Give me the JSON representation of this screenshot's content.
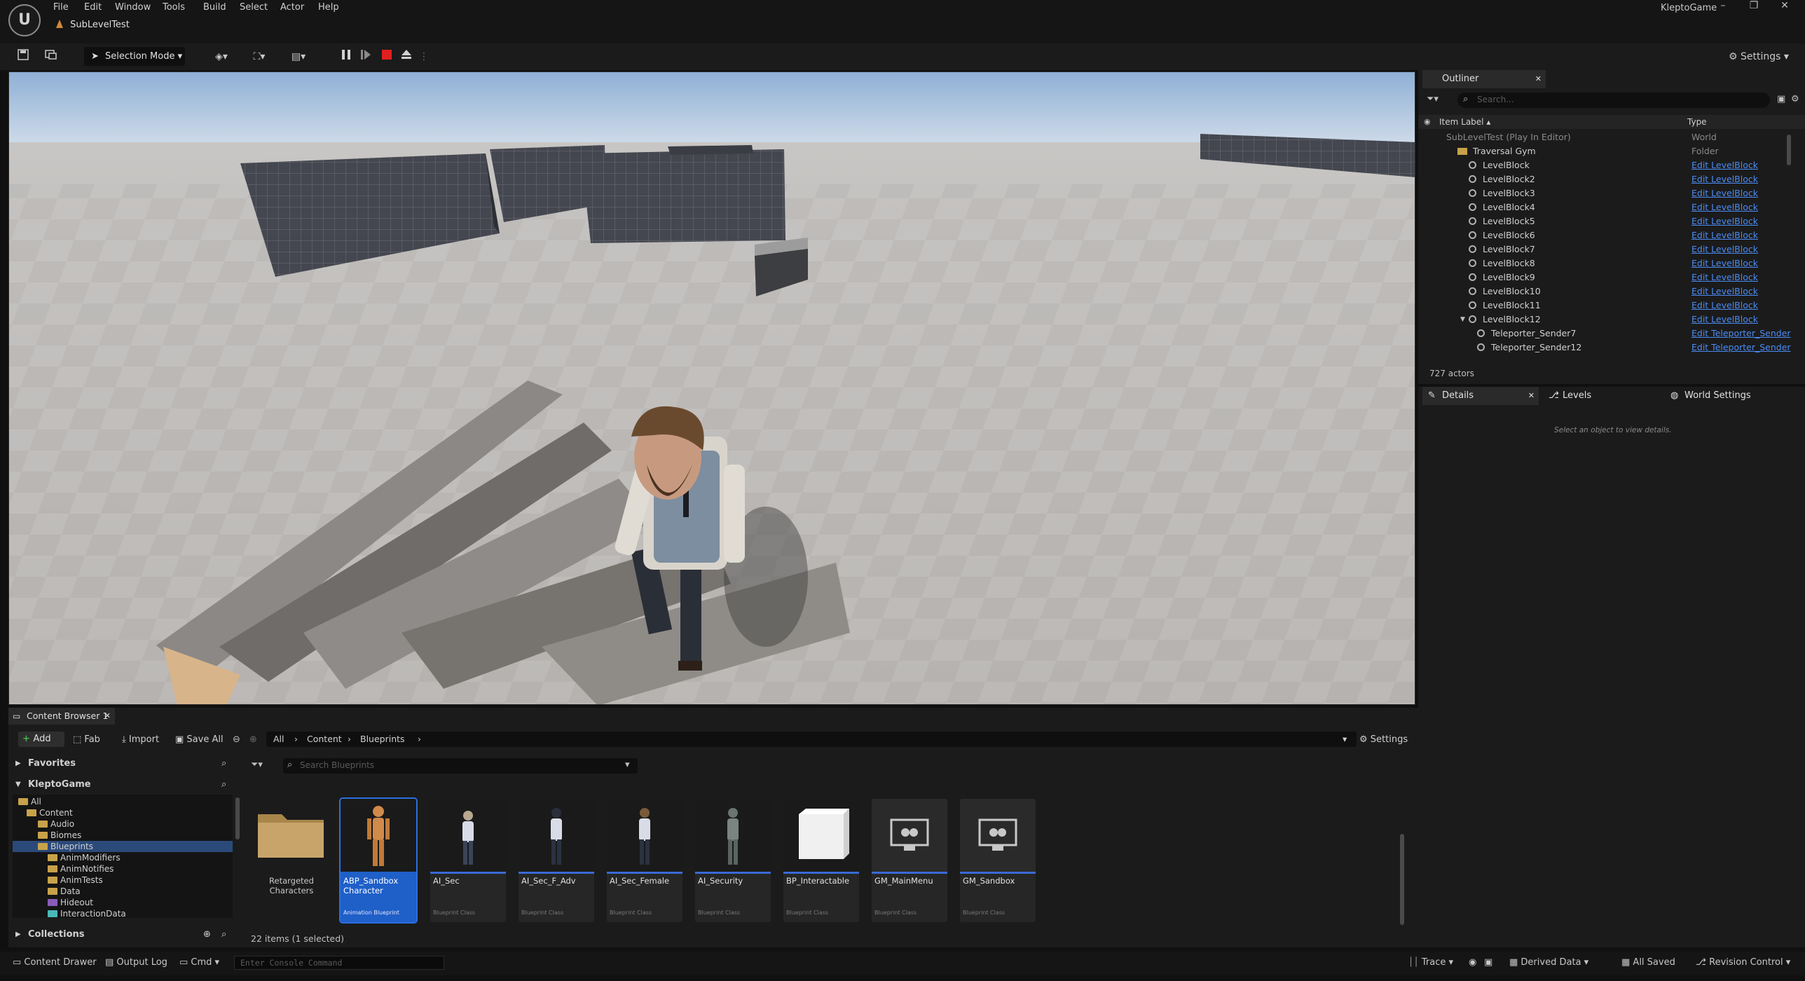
{
  "window": {
    "app_title": "KleptoGame",
    "level_tab": "SubLevelTest",
    "menu": [
      "File",
      "Edit",
      "Window",
      "Tools",
      "Build",
      "Select",
      "Actor",
      "Help"
    ],
    "minimize": "–",
    "maximize": "❐",
    "close": "✕"
  },
  "toolbar": {
    "selection_mode": "Selection Mode",
    "settings": "Settings"
  },
  "outliner": {
    "tab": "Outliner",
    "search_placeholder": "Search...",
    "col_label": "Item Label ▴",
    "col_type": "Type",
    "rows": [
      {
        "label": "SubLevelTest (Play In Editor)",
        "type": "World"
      },
      {
        "label": "Traversal Gym",
        "type": "Folder"
      },
      {
        "label": "LevelBlock",
        "type": "Edit LevelBlock"
      },
      {
        "label": "LevelBlock2",
        "type": "Edit LevelBlock"
      },
      {
        "label": "LevelBlock3",
        "type": "Edit LevelBlock"
      },
      {
        "label": "LevelBlock4",
        "type": "Edit LevelBlock"
      },
      {
        "label": "LevelBlock5",
        "type": "Edit LevelBlock"
      },
      {
        "label": "LevelBlock6",
        "type": "Edit LevelBlock"
      },
      {
        "label": "LevelBlock7",
        "type": "Edit LevelBlock"
      },
      {
        "label": "LevelBlock8",
        "type": "Edit LevelBlock"
      },
      {
        "label": "LevelBlock9",
        "type": "Edit LevelBlock"
      },
      {
        "label": "LevelBlock10",
        "type": "Edit LevelBlock"
      },
      {
        "label": "LevelBlock11",
        "type": "Edit LevelBlock"
      },
      {
        "label": "LevelBlock12",
        "type": "Edit LevelBlock"
      },
      {
        "label": "Teleporter_Sender7",
        "type": "Edit Teleporter_Sender"
      },
      {
        "label": "Teleporter_Sender12",
        "type": "Edit Teleporter_Sender"
      }
    ],
    "actor_count": "727 actors"
  },
  "details": {
    "tab_details": "Details",
    "tab_levels": "Levels",
    "tab_world": "World Settings",
    "empty": "Select an object to view details."
  },
  "content_browser": {
    "tab": "Content Browser 1",
    "add": "Add",
    "fab": "Fab",
    "import": "Import",
    "save_all": "Save All",
    "settings": "Settings",
    "breadcrumb": [
      "All",
      "Content",
      "Blueprints"
    ],
    "search_placeholder": "Search Blueprints",
    "favorites": "Favorites",
    "project": "KleptoGame",
    "collections": "Collections",
    "tree": [
      {
        "label": "All",
        "level": 0
      },
      {
        "label": "Content",
        "level": 1
      },
      {
        "label": "Audio",
        "level": 2
      },
      {
        "label": "Biomes",
        "level": 2
      },
      {
        "label": "Blueprints",
        "level": 2
      },
      {
        "label": "AnimModifiers",
        "level": 3
      },
      {
        "label": "AnimNotifies",
        "level": 3
      },
      {
        "label": "AnimTests",
        "level": 3
      },
      {
        "label": "Data",
        "level": 3
      },
      {
        "label": "Hideout",
        "level": 3
      },
      {
        "label": "InteractionData",
        "level": 3
      }
    ],
    "assets": [
      {
        "name": "Retargeted Characters",
        "kind": ""
      },
      {
        "name": "ABP_Sandbox Character",
        "kind": "Animation Blueprint"
      },
      {
        "name": "AI_Sec",
        "kind": "Blueprint Class"
      },
      {
        "name": "AI_Sec_F_Adv",
        "kind": "Blueprint Class"
      },
      {
        "name": "AI_Sec_Female",
        "kind": "Blueprint Class"
      },
      {
        "name": "AI_Security",
        "kind": "Blueprint Class"
      },
      {
        "name": "BP_Interactable",
        "kind": "Blueprint Class"
      },
      {
        "name": "GM_MainMenu",
        "kind": "Blueprint Class"
      },
      {
        "name": "GM_Sandbox",
        "kind": "Blueprint Class"
      }
    ],
    "item_count": "22 items (1 selected)"
  },
  "statusbar": {
    "content_drawer": "Content Drawer",
    "output_log": "Output Log",
    "cmd": "Cmd",
    "console_placeholder": "Enter Console Command",
    "trace": "Trace",
    "derived_data": "Derived Data",
    "all_saved": "All Saved",
    "revision_control": "Revision Control"
  },
  "colors": {
    "accent": "#3a6ad6",
    "record": "#e02020",
    "link": "#4b8cf5"
  }
}
